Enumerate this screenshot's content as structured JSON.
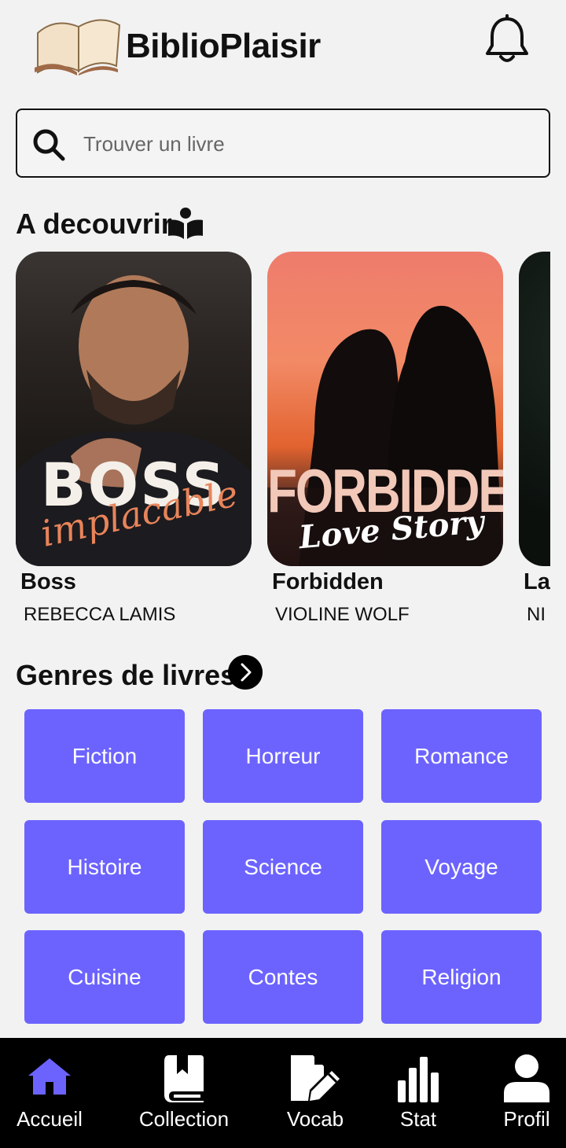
{
  "app": {
    "title": "BiblioPlaisir"
  },
  "search": {
    "placeholder": "Trouver un livre"
  },
  "discover": {
    "title": "A decouvrir",
    "books": [
      {
        "title": "Boss",
        "author": "REBECCA LAMIS",
        "cover_text": "BOSS",
        "cover_script": "implacable"
      },
      {
        "title": "Forbidden",
        "author": "VIOLINE WOLF",
        "cover_text": "FORBIDDEN",
        "cover_script": "Love Story"
      },
      {
        "title": "La",
        "author": "NI"
      }
    ]
  },
  "genres": {
    "title": "Genres de livres",
    "items": [
      "Fiction",
      "Horreur",
      "Romance",
      "Histoire",
      "Science",
      "Voyage",
      "Cuisine",
      "Contes",
      "Religion"
    ]
  },
  "nav": {
    "items": [
      {
        "label": "Accueil",
        "icon": "home-icon",
        "active": true
      },
      {
        "label": "Collection",
        "icon": "bookmark-book-icon",
        "active": false
      },
      {
        "label": "Vocab",
        "icon": "file-pen-icon",
        "active": false
      },
      {
        "label": "Stat",
        "icon": "bar-chart-icon",
        "active": false
      },
      {
        "label": "Profil",
        "icon": "user-icon",
        "active": false
      }
    ]
  },
  "colors": {
    "accent": "#6c63ff",
    "background": "#f2f2f2",
    "nav_background": "#000000"
  }
}
